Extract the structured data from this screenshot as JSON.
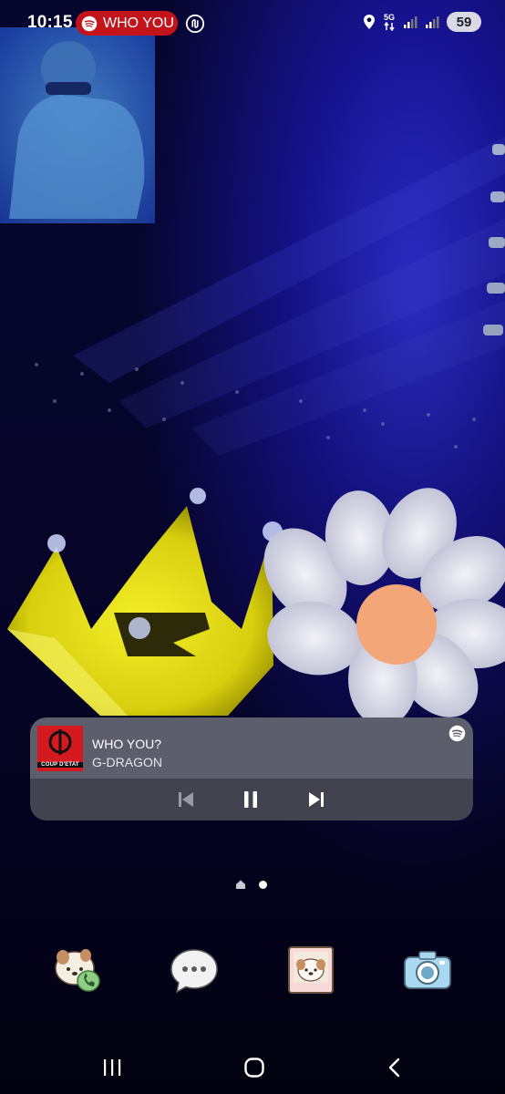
{
  "status_bar": {
    "time": "10:15",
    "media_chip": {
      "text": "WHO YOU",
      "color": "#c4141b",
      "icon": "spotify-icon"
    },
    "nfc_icon": "nfc-icon",
    "location_icon": "location-icon",
    "network": {
      "label": "5G",
      "icon": "data-arrows-icon"
    },
    "signal_icons": [
      "signal-icon",
      "signal-icon"
    ],
    "battery": "59"
  },
  "wallpaper": {
    "description": "concert-photo"
  },
  "media_widget": {
    "title": "WHO YOU?",
    "artist": "G-DRAGON",
    "album_label": "COUP D'ETAT",
    "source_icon": "spotify-icon",
    "controls": [
      "previous-icon",
      "pause-icon",
      "next-icon"
    ]
  },
  "page_indicator": {
    "items": [
      "home-icon",
      "page-dot"
    ]
  },
  "dock": {
    "apps": [
      {
        "name": "phone",
        "icon": "phone-dog-icon"
      },
      {
        "name": "messages",
        "icon": "chat-bubble-icon"
      },
      {
        "name": "gallery",
        "icon": "dog-photo-icon"
      },
      {
        "name": "camera",
        "icon": "camera-icon"
      }
    ]
  },
  "nav_bar": {
    "buttons": [
      "recents-icon",
      "home-icon",
      "back-icon"
    ]
  },
  "colors": {
    "accent": "#c4141b",
    "widget_bg": "#5d5e6c",
    "widget_controls_bg": "#43434f"
  }
}
